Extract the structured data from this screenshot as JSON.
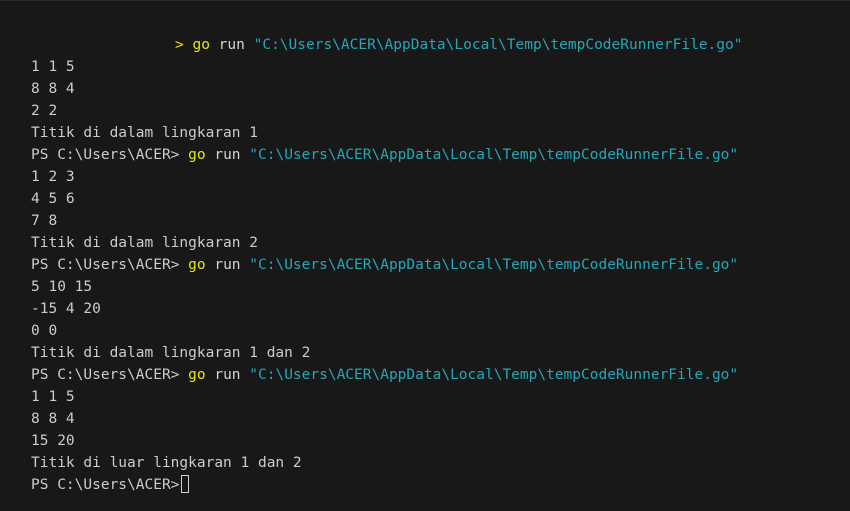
{
  "terminal": {
    "prompt": "PS C:\\Users\\ACER>",
    "command": "go",
    "command_arg": "run",
    "path": "\"C:\\Users\\ACER\\AppData\\Local\\Temp\\tempCodeRunnerFile.go\"",
    "first_prompt_marker": ">",
    "runs": [
      {
        "inputs": [
          "1 1 5",
          "8 8 4",
          "2 2"
        ],
        "result": "Titik di dalam lingkaran 1"
      },
      {
        "inputs": [
          "1 2 3",
          "4 5 6",
          "7 8"
        ],
        "result": "Titik di dalam lingkaran 2"
      },
      {
        "inputs": [
          "5 10 15",
          "-15 4 20",
          "0 0"
        ],
        "result": "Titik di dalam lingkaran 1 dan 2"
      },
      {
        "inputs": [
          "1 1 5",
          "8 8 4",
          "15 20"
        ],
        "result": "Titik di luar lingkaran 1 dan 2"
      }
    ]
  }
}
